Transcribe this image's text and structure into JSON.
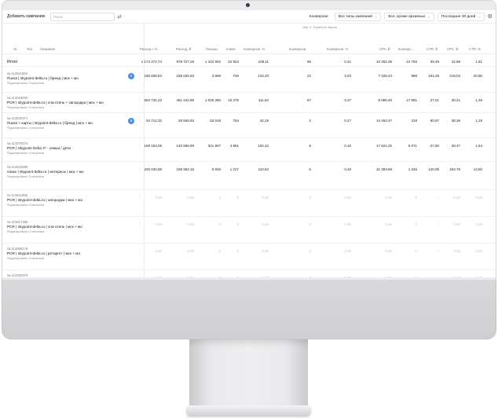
{
  "toolbar": {
    "add_campaign": "Добавить кампанию",
    "search_placeholder": "Поиск",
    "conversions": "Конверсии",
    "campaign_types": "Все типы кампаний",
    "archive_filter": "Все, кроме архивных",
    "period": "Последние 30 дней"
  },
  "goal_label": "Шаг 4. TravelLine бронь",
  "headers": {
    "num": "№",
    "type": "Тип",
    "name": "Название",
    "cost_vat": "Расход с Н...",
    "cost": "Расход, ₽",
    "impressions": "Показы",
    "clicks": "Клики",
    "conv_pct": "Конверсия, %",
    "conversions": "Конверсии",
    "conv_pct2": "Конверсия, %",
    "cpa": "CPA, ₽",
    "conv_short": "Конверс...",
    "ctr_rub": "CTR, ₽",
    "cpc": "CPC, ₽",
    "ctr": "CTR, %"
  },
  "total": {
    "label": "Итого",
    "values": [
      "1 174 472,74",
      "978 727,29",
      "1 422 502",
      "22 924",
      "108,11",
      "95",
      "0,41",
      "10 302,39",
      "24 783",
      "39,49",
      "42,69",
      "1,61"
    ]
  },
  "rows": [
    {
      "id": "№ 113511663",
      "title": "Поиск | skypoint-delta.ru | бренд | мск + мо",
      "links": "Редактировать   Статистика",
      "badge": "6",
      "values": [
        "190 838,84",
        "159 025,53",
        "3 598",
        "726",
        "133,33",
        "22",
        "3,03",
        "7 228,43",
        "968",
        "164,28",
        "219,04",
        "20,90"
      ]
    },
    {
      "id": "№ 113518002",
      "title": "PCR | skypoint-delta.ru | спа-отель + загородка | мск + мо",
      "links": "Редактировать   Статистика",
      "badge": "",
      "values": [
        "553 731,22",
        "461 442,69",
        "1 025 290",
        "15 276",
        "111,62",
        "57",
        "0,37",
        "8 095,49",
        "17 081",
        "27,01",
        "30,21",
        "1,49"
      ]
    },
    {
      "id": "№ 113540371",
      "title": "Поиск + карты | skypoint-delta.ru | бренд | мск + мо",
      "links": "Редактировать   Статистика",
      "badge": "6",
      "values": [
        "34 712,32",
        "28 926,93",
        "63 619",
        "754",
        "42,18",
        "2",
        "0,27",
        "14 463,47",
        "318",
        "90,97",
        "38,36",
        "1,19"
      ]
    },
    {
      "id": "№ 114076674",
      "title": "PCR | Skypoint Delta 4* - семьи / дети",
      "links": "Редактировать   Статистика",
      "badge": "",
      "values": [
        "169 163,08",
        "140 969,99",
        "321 607",
        "4 951",
        "102,42",
        "8",
        "0,16",
        "17 621,25",
        "5 071",
        "27,80",
        "28,47",
        "1,54"
      ]
    },
    {
      "id": "№ 113510669",
      "title": "поиск | skypoint-delta.ru | интересы | мск + мо",
      "links": "Редактировать   Статистика",
      "badge": "",
      "values": [
        "226 034,58",
        "188 362,15",
        "8 948",
        "1 217",
        "110,52",
        "6",
        "0,49",
        "31 393,69",
        "1 345",
        "140,05",
        "154,78",
        "13,60"
      ]
    },
    {
      "id": "№ 113511986",
      "title": "PCR | skypoint-delta.ru | загородка | мск + мо",
      "links": "Редактировать   Статистика",
      "badge": "",
      "values": [
        "0,00",
        "0,00",
        "0",
        "0",
        "0,00",
        "0",
        "0,00",
        "0,00",
        "0",
        "–",
        "0,00",
        "0,00"
      ]
    },
    {
      "id": "№ 113517366",
      "title": "PCR | skypoint-delta.ru | спа-отель | мск + мо",
      "links": "Редактировать   Статистика",
      "badge": "",
      "values": [
        "0,00",
        "0,00",
        "0",
        "0",
        "0,00",
        "0",
        "0,00",
        "0,00",
        "0",
        "–",
        "0,00",
        "0,00"
      ]
    },
    {
      "id": "№ 113559179",
      "title": "PCR | skypoint-delta.ru | ретаргет | мск + мо",
      "links": "Редактировать   Статистика",
      "badge": "",
      "values": [
        "0,00",
        "0,00",
        "0",
        "0",
        "0,00",
        "0",
        "0,00",
        "0,00",
        "0",
        "–",
        "0,00",
        "0,00"
      ]
    },
    {
      "id": "№ 114092870",
      "title": "PCR | Skypoint Delta 4* - Военные / пожарн. / доп.3м",
      "links": "",
      "badge": "",
      "values": [
        "0,00",
        "0,00",
        "0",
        "0",
        "0,00",
        "0",
        "0,00",
        "0,00",
        "0",
        "–",
        "0,00",
        "0,00"
      ]
    }
  ]
}
